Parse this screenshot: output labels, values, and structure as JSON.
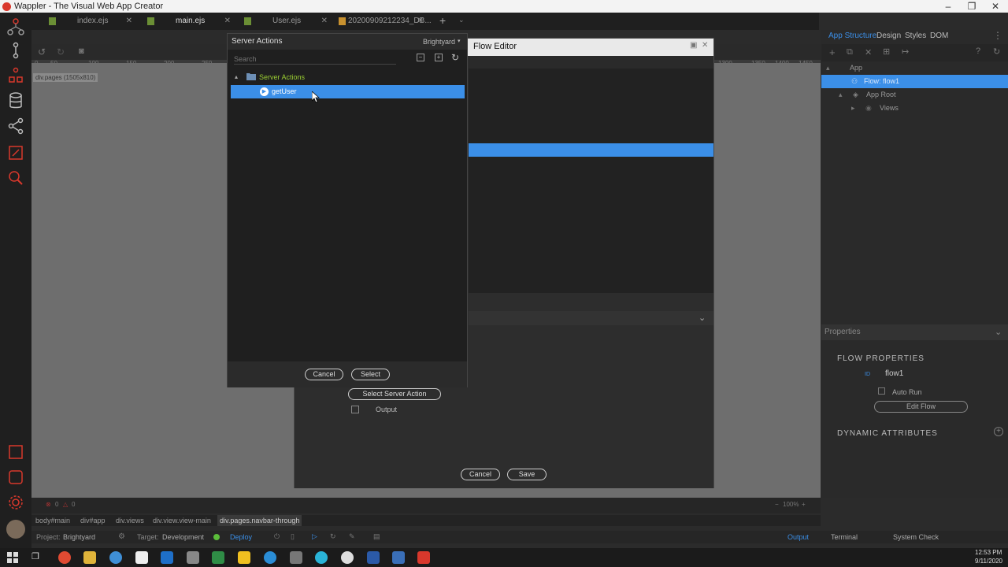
{
  "window": {
    "title": "Wappler - The Visual Web App Creator"
  },
  "tabs": [
    {
      "label": "index.ejs"
    },
    {
      "label": "main.ejs"
    },
    {
      "label": "User.ejs"
    },
    {
      "label": "20200909212234_DB..."
    }
  ],
  "canvas": {
    "page_label": "div.pages (1505x810)",
    "ruler_ticks": [
      "0",
      "50",
      "100",
      "150",
      "200",
      "250",
      "1300",
      "1350",
      "1400",
      "1450"
    ]
  },
  "flow_editor": {
    "title": "Flow Editor",
    "select_server_action_label": "Select Server Action",
    "output_label": "Output",
    "cancel_label": "Cancel",
    "save_label": "Save"
  },
  "server_actions": {
    "title": "Server Actions",
    "project": "Brightyard",
    "search_placeholder": "Search",
    "tree": {
      "folder": "Server Actions",
      "items": [
        {
          "label": "getUser"
        }
      ]
    },
    "cancel_label": "Cancel",
    "select_label": "Select"
  },
  "right_panel": {
    "tabs": [
      "App Structure",
      "Design",
      "Styles",
      "DOM"
    ],
    "tree": {
      "app": "App",
      "flow": "Flow: flow1",
      "app_root": "App Root",
      "views": "Views"
    },
    "properties_title": "Properties",
    "flow_properties_title": "FLOW PROPERTIES",
    "id_label": "ID",
    "id_value": "flow1",
    "auto_run_label": "Auto Run",
    "edit_flow_label": "Edit Flow",
    "dynamic_attributes_title": "DYNAMIC ATTRIBUTES"
  },
  "breadcrumb": [
    "body#main",
    "div#app",
    "div.views",
    "div.view.view-main",
    "div.pages.navbar-through"
  ],
  "status": {
    "errors": "0",
    "warnings": "0",
    "zoom": "100%",
    "project_label": "Project:",
    "project": "Brightyard",
    "target_label": "Target:",
    "target": "Development",
    "deploy": "Deploy",
    "output": "Output",
    "terminal": "Terminal",
    "system_check": "System Check"
  },
  "taskbar": {
    "time": "12:53 PM",
    "date": "9/11/2020"
  },
  "colors": {
    "accent": "#3b8fe8",
    "folder": "#9acd32"
  }
}
